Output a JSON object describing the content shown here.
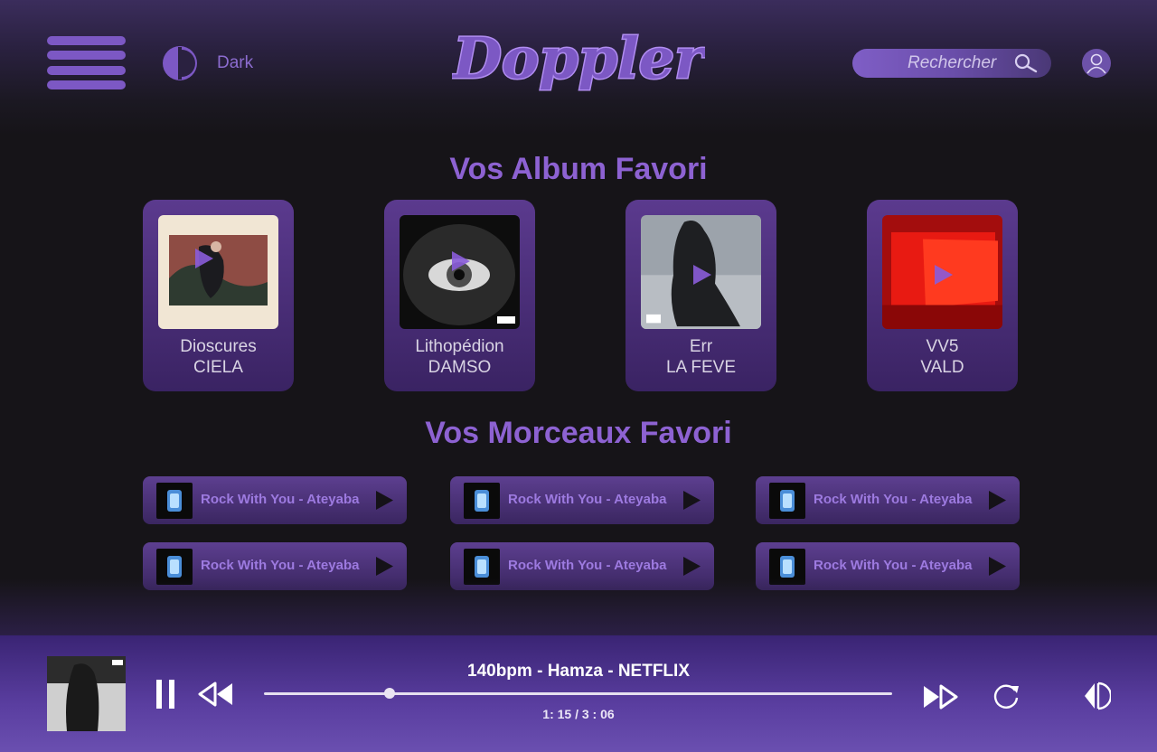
{
  "header": {
    "theme_label": "Dark",
    "logo_text": "Doppler",
    "search_placeholder": "Rechercher"
  },
  "albums_section": {
    "title": "Vos Album Favori",
    "items": [
      {
        "title": "Dioscures",
        "artist": "CIELA"
      },
      {
        "title": "Lithopédion",
        "artist": "DAMSO"
      },
      {
        "title": "Err",
        "artist": "LA FEVE"
      },
      {
        "title": "VV5",
        "artist": "VALD"
      }
    ]
  },
  "tracks_section": {
    "title": "Vos Morceaux Favori",
    "items": [
      {
        "label": "Rock With You - Ateyaba"
      },
      {
        "label": "Rock With You - Ateyaba"
      },
      {
        "label": "Rock With You - Ateyaba"
      },
      {
        "label": "Rock With You - Ateyaba"
      },
      {
        "label": "Rock With You - Ateyaba"
      },
      {
        "label": "Rock With You - Ateyaba"
      }
    ]
  },
  "player": {
    "title": "140bpm - Hamza - NETFLIX",
    "time": "1: 15 / 3 : 06",
    "progress_fraction": 0.2
  },
  "colors": {
    "accent": "#7c58c4",
    "accent_text": "#8d62d2",
    "player_bg": "#5a3ea0"
  }
}
